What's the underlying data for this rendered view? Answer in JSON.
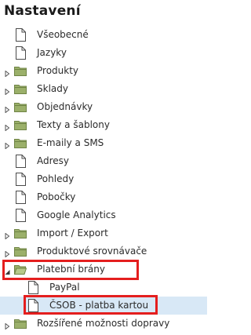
{
  "panel": {
    "title": "Nastavení"
  },
  "tree": [
    {
      "label": "Všeobecné",
      "icon": "file-icon",
      "level": 0,
      "toggle": "none"
    },
    {
      "label": "Jazyky",
      "icon": "file-icon",
      "level": 0,
      "toggle": "none"
    },
    {
      "label": "Produkty",
      "icon": "folder-icon",
      "level": 0,
      "toggle": "collapsed"
    },
    {
      "label": "Sklady",
      "icon": "folder-icon",
      "level": 0,
      "toggle": "collapsed"
    },
    {
      "label": "Objednávky",
      "icon": "folder-icon",
      "level": 0,
      "toggle": "collapsed"
    },
    {
      "label": "Texty a šablony",
      "icon": "folder-icon",
      "level": 0,
      "toggle": "collapsed"
    },
    {
      "label": "E-maily a SMS",
      "icon": "folder-icon",
      "level": 0,
      "toggle": "collapsed"
    },
    {
      "label": "Adresy",
      "icon": "file-icon",
      "level": 0,
      "toggle": "none"
    },
    {
      "label": "Pohledy",
      "icon": "file-icon",
      "level": 0,
      "toggle": "none"
    },
    {
      "label": "Pobočky",
      "icon": "file-icon",
      "level": 0,
      "toggle": "none"
    },
    {
      "label": "Google Analytics",
      "icon": "file-icon",
      "level": 0,
      "toggle": "none"
    },
    {
      "label": "Import / Export",
      "icon": "folder-icon",
      "level": 0,
      "toggle": "collapsed"
    },
    {
      "label": "Produktové srovnávače",
      "icon": "folder-icon",
      "level": 0,
      "toggle": "collapsed"
    },
    {
      "label": "Platební brány",
      "icon": "folder-icon",
      "level": 0,
      "toggle": "expanded",
      "highlighted": true
    },
    {
      "label": "PayPal",
      "icon": "file-icon",
      "level": 1,
      "toggle": "none"
    },
    {
      "label": "ČSOB - platba kartou",
      "icon": "file-icon",
      "level": 1,
      "toggle": "none",
      "selected": true,
      "highlighted": true
    },
    {
      "label": "Rozšířené možnosti dopravy",
      "icon": "folder-icon",
      "level": 0,
      "toggle": "collapsed"
    }
  ],
  "colors": {
    "selection_bg": "#d8e8f6",
    "highlight_border": "#e41e1e",
    "folder_fill": "#9bb06a",
    "folder_stroke": "#6f8445"
  }
}
